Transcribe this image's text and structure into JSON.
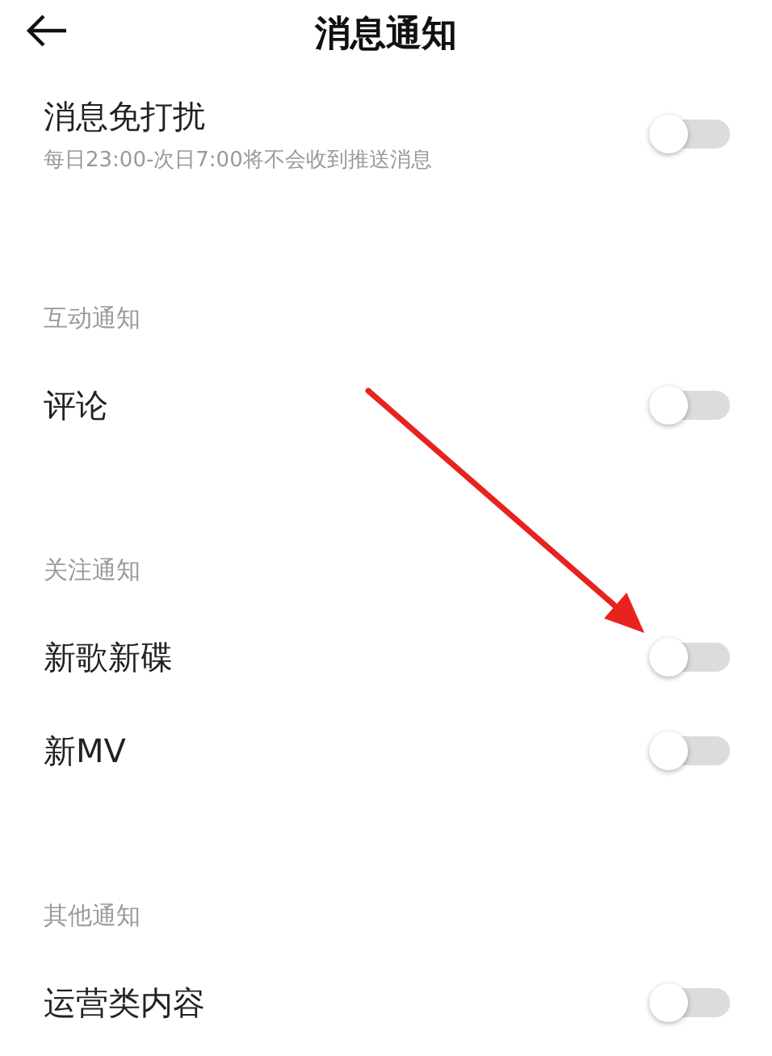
{
  "header": {
    "title": "消息通知"
  },
  "sections": [
    {
      "items": [
        {
          "label": "消息免打扰",
          "subtitle": "每日23:00-次日7:00将不会收到推送消息",
          "on": false
        }
      ]
    },
    {
      "title": "互动通知",
      "items": [
        {
          "label": "评论",
          "on": false
        }
      ]
    },
    {
      "title": "关注通知",
      "items": [
        {
          "label": "新歌新碟",
          "on": false
        },
        {
          "label": "新MV",
          "on": false
        }
      ]
    },
    {
      "title": "其他通知",
      "items": [
        {
          "label": "运营类内容",
          "on": false
        }
      ]
    }
  ]
}
